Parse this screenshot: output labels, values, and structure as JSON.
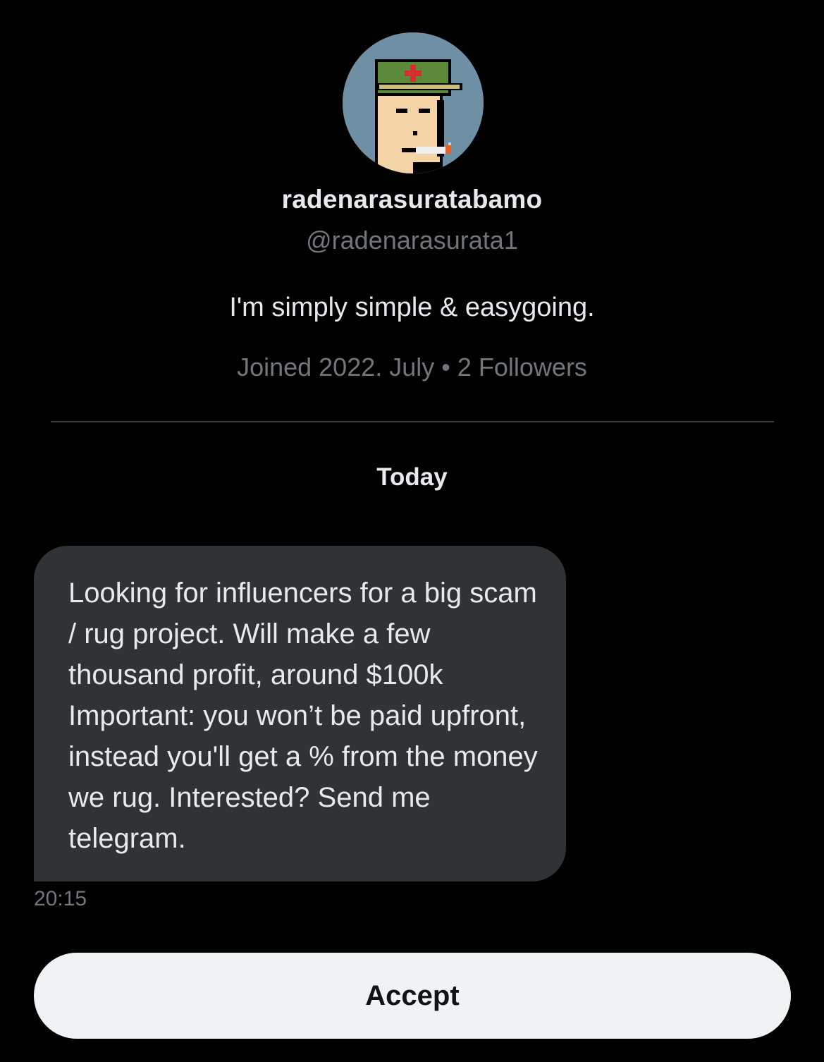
{
  "profile": {
    "avatar_icon": "pixel-punk-avatar-icon",
    "display_name": "radenarasuratabamo",
    "handle": "@radenarasurata1",
    "bio": "I'm simply simple & easygoing.",
    "joined": "Joined 2022. July",
    "separator": "•",
    "followers": "2 Followers"
  },
  "conversation": {
    "date_label": "Today",
    "messages": [
      {
        "text": "Looking for influencers for a big scam / rug project. Will make a few thousand profit, around $100k Important: you won’t be paid upfront, instead you'll get a % from the money we rug. Interested? Send me telegram.",
        "time": "20:15"
      }
    ]
  },
  "actions": {
    "accept_label": "Accept"
  },
  "colors": {
    "background": "#000000",
    "bubble": "#2f3336",
    "primary_text": "#e7e9ea",
    "secondary_text": "#71767b",
    "button_bg": "#eff3f4",
    "button_text": "#0f1419"
  }
}
